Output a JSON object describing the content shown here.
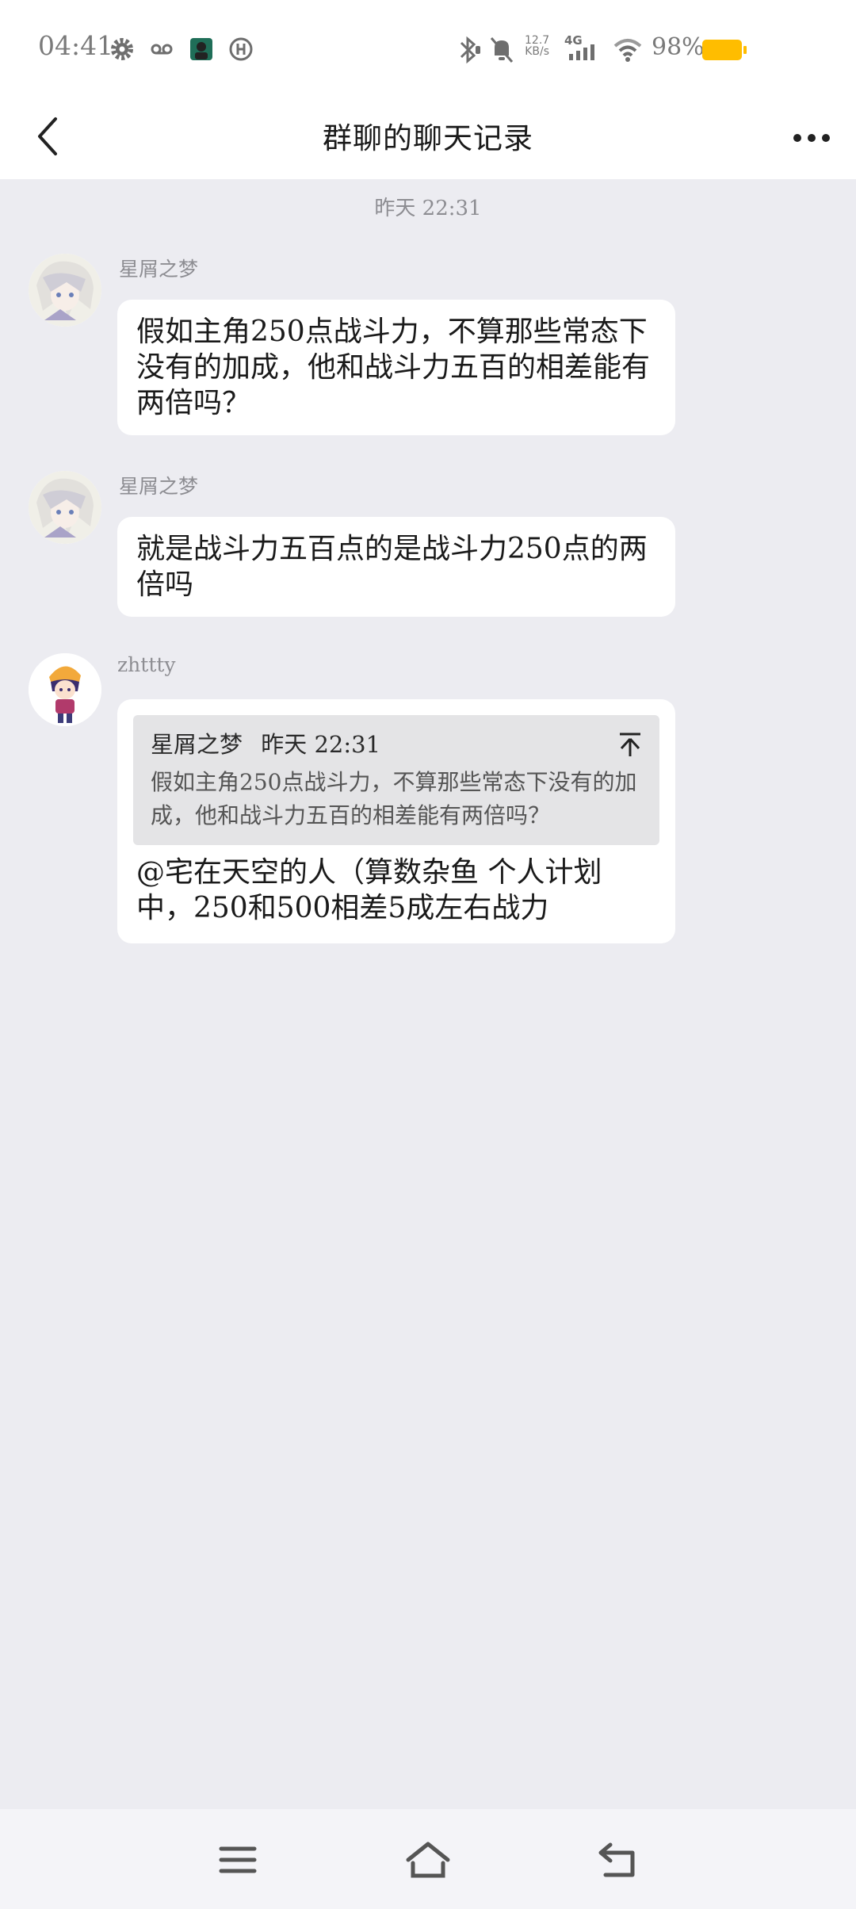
{
  "status_bar": {
    "time": "04:41",
    "net_speed_value": "12.7",
    "net_speed_unit": "KB/s",
    "network_type": "4G",
    "battery_percent": "98%",
    "battery_level": 0.98,
    "battery_color": "#ffbd00",
    "left_icons": [
      "settings-gear-icon",
      "voicemail-icon",
      "app-notification-icon",
      "app-logo-icon"
    ],
    "right_icons": [
      "bluetooth-icon",
      "silent-bell-icon",
      "signal-icon",
      "wifi-icon",
      "battery-icon"
    ]
  },
  "header": {
    "title": "群聊的聊天记录",
    "back_icon": "chevron-left-icon",
    "more_icon": "more-dots-icon"
  },
  "chat": {
    "timestamp": "昨天 22:31",
    "messages": [
      {
        "sender": "星屑之梦",
        "text": "假如主角250点战斗力，不算那些常态下没有的加成，他和战斗力五百的相差能有两倍吗？"
      },
      {
        "sender": "星屑之梦",
        "text": "就是战斗力五百点的是战斗力250点的两倍吗"
      },
      {
        "sender": "zhttty",
        "quote": {
          "sender": "星屑之梦",
          "time": "昨天 22:31",
          "text": "假如主角250点战斗力，不算那些常态下没有的加成，他和战斗力五百的相差能有两倍吗？",
          "jump_icon": "jump-to-top-icon"
        },
        "text": "@宅在天空的人（算数杂鱼 个人计划中，250和500相差5成左右战力"
      }
    ]
  },
  "bottom_nav": {
    "icons": [
      "menu-icon",
      "home-icon",
      "back-return-icon"
    ]
  }
}
